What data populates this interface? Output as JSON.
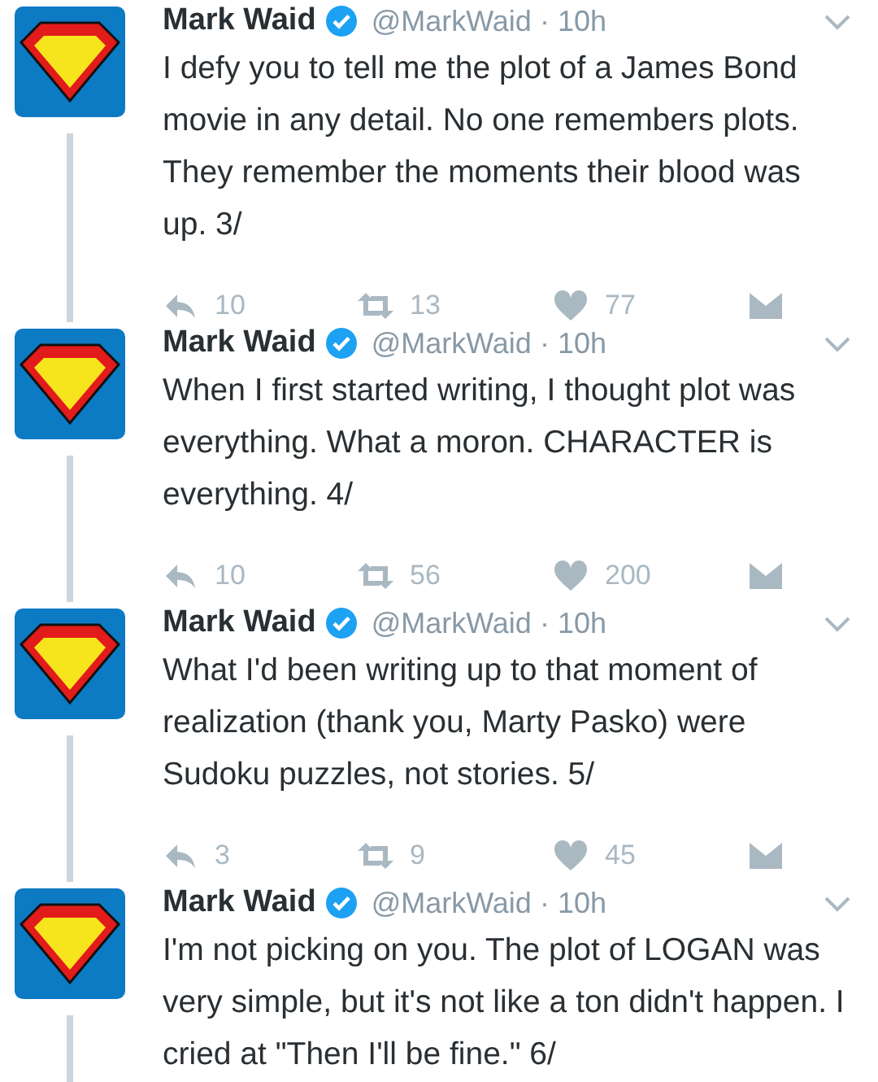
{
  "tweets": [
    {
      "name": "Mark Waid",
      "verified": true,
      "handle": "@MarkWaid",
      "time": "· 10h",
      "text": "I defy you to tell me the plot of a James Bond movie in any detail. No one remembers plots. They remember the moments their blood was up. 3/",
      "replies": "10",
      "retweets": "13",
      "likes": "77"
    },
    {
      "name": "Mark Waid",
      "verified": true,
      "handle": "@MarkWaid",
      "time": "· 10h",
      "text": "When I first started writing, I thought plot was everything. What a moron. CHARACTER is everything. 4/",
      "replies": "10",
      "retweets": "56",
      "likes": "200"
    },
    {
      "name": "Mark Waid",
      "verified": true,
      "handle": "@MarkWaid",
      "time": "· 10h",
      "text": "What I'd been writing up to that moment of realization (thank you, Marty Pasko) were Sudoku puzzles, not stories. 5/",
      "replies": "3",
      "retweets": "9",
      "likes": "45"
    },
    {
      "name": "Mark Waid",
      "verified": true,
      "handle": "@MarkWaid",
      "time": "· 10h",
      "text": "I'm not picking on you. The plot of LOGAN was very simple, but it's not like a ton didn't happen. I cried at \"Then I'll be fine.\" 6/"
    }
  ]
}
